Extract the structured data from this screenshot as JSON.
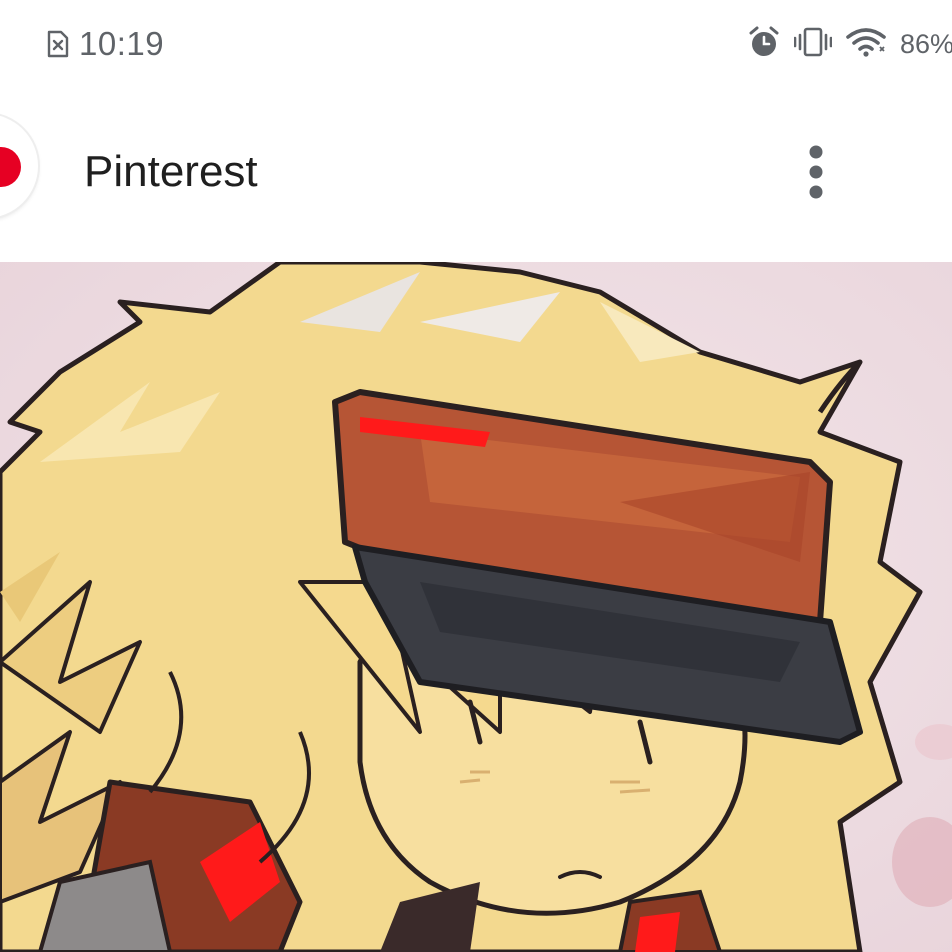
{
  "status_bar": {
    "time": "10:19",
    "battery": "86%",
    "icons": [
      "no-sim-icon",
      "alarm-icon",
      "vibrate-icon",
      "wifi-icon"
    ]
  },
  "header": {
    "app_name": "Pinterest",
    "logo": "pinterest-logo-icon",
    "menu_icon": "more-vertical-icon"
  },
  "colors": {
    "status_icon": "#5f6368",
    "title_text": "#1f1f1f",
    "brand_red": "#e60023"
  }
}
